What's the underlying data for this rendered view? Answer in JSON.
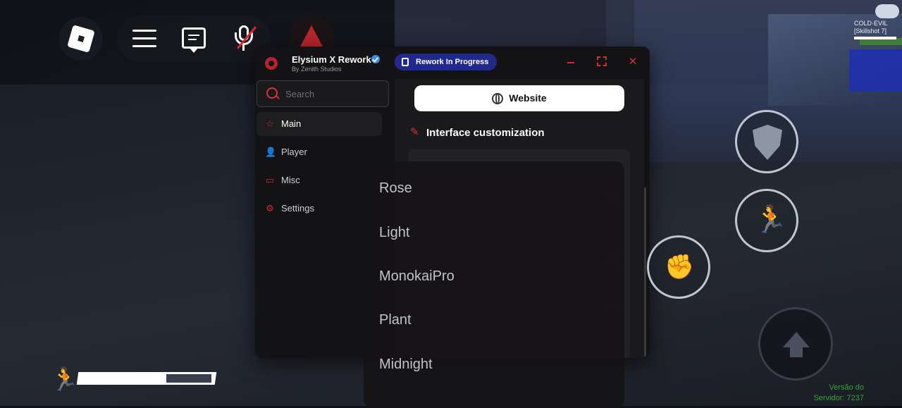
{
  "game": {
    "top_right_tag": [
      "COLD·EVIL",
      "[Skillshot 7]"
    ],
    "version_text": [
      "Versão do",
      "Servidor: 7237"
    ]
  },
  "topbar": {
    "icons": [
      "roblox-logo",
      "menu-icon",
      "chat-icon",
      "mic-muted-icon",
      "triangle-icon"
    ]
  },
  "window": {
    "title": "Elysium X Rework",
    "subtitle": "By Zenith Studios",
    "badge": "Rework In Progress",
    "controls": [
      "minimize",
      "maximize",
      "close"
    ],
    "accent_color": "#d72b35",
    "badge_color": "#1f2a8c"
  },
  "sidebar": {
    "search_placeholder": "Search",
    "items": [
      {
        "label": "Main",
        "icon": "star-icon",
        "active": true
      },
      {
        "label": "Player",
        "icon": "user-icon",
        "active": false
      },
      {
        "label": "Misc",
        "icon": "folder-icon",
        "active": false
      },
      {
        "label": "Settings",
        "icon": "gear-icon",
        "active": false
      }
    ]
  },
  "content": {
    "website_button": "Website",
    "section_title": "Interface customization"
  },
  "dropdown": {
    "options": [
      "Rose",
      "Light",
      "MonokaiPro",
      "Plant",
      "Midnight"
    ]
  },
  "stamina": {
    "level": 0.65
  }
}
